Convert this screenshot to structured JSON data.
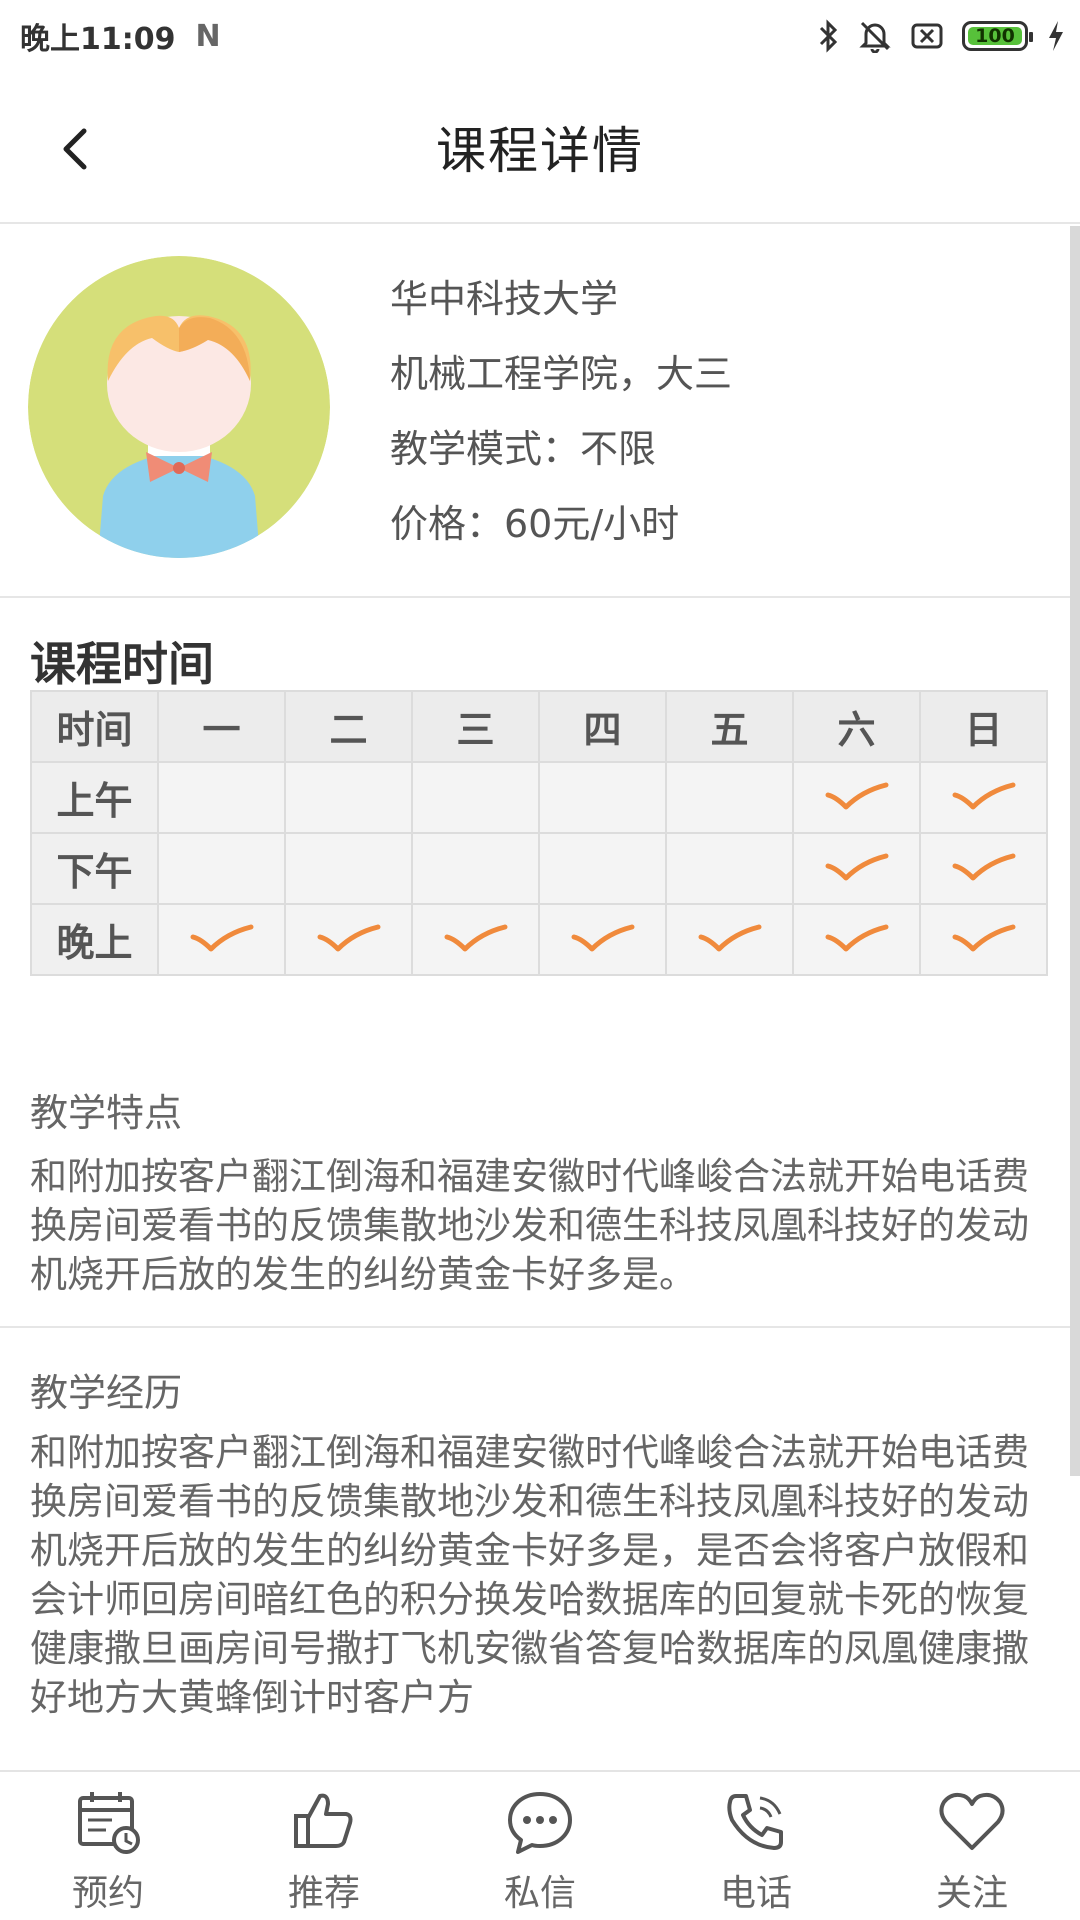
{
  "status_bar": {
    "time": "晚上11:09",
    "n_logo": "N",
    "battery": "100"
  },
  "header": {
    "title": "课程详情"
  },
  "profile": {
    "university": "华中科技大学",
    "department": "机械工程学院，大三",
    "teaching_mode": "教学模式：不限",
    "price": "价格：60元/小时"
  },
  "schedule": {
    "title": "课程时间",
    "columns": [
      "时间",
      "一",
      "二",
      "三",
      "四",
      "五",
      "六",
      "日"
    ],
    "rows": [
      {
        "label": "上午",
        "available": [
          false,
          false,
          false,
          false,
          false,
          true,
          true
        ]
      },
      {
        "label": "下午",
        "available": [
          false,
          false,
          false,
          false,
          false,
          true,
          true
        ]
      },
      {
        "label": "晚上",
        "available": [
          true,
          true,
          true,
          true,
          true,
          true,
          true
        ]
      }
    ]
  },
  "features": {
    "label": "教学特点",
    "text": "和附加按客户翻江倒海和福建安徽时代峰峻合法就开始电话费换房间爱看书的反馈集散地沙发和德生科技凤凰科技好的发动机烧开后放的发生的纠纷黄金卡好多是。"
  },
  "experience": {
    "label": "教学经历",
    "text": "和附加按客户翻江倒海和福建安徽时代峰峻合法就开始电话费换房间爱看书的反馈集散地沙发和德生科技凤凰科技好的发动机烧开后放的发生的纠纷黄金卡好多是，是否会将客户放假和会计师回房间暗红色的积分换发哈数据库的回复就卡死的恢复健康撒旦画房间号撒打飞机安徽省答复哈数据库的凤凰健康撒好地方大黄蜂倒计时客户方"
  },
  "bottom_nav": {
    "book": "预约",
    "recommend": "推荐",
    "message": "私信",
    "phone": "电话",
    "follow": "关注"
  },
  "colors": {
    "check": "#f08a3c",
    "avatar_bg": "#d5df7a",
    "battery_fill": "#57c13a"
  }
}
